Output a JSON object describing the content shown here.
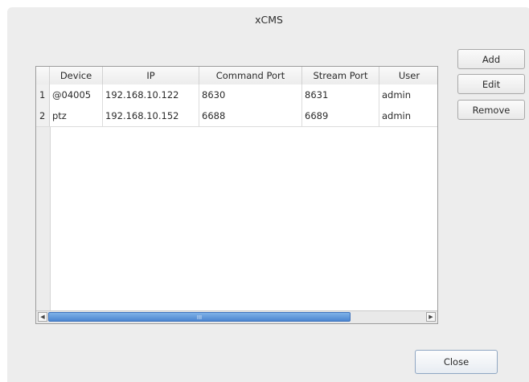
{
  "window": {
    "title": "xCMS"
  },
  "buttons": {
    "add": "Add",
    "edit": "Edit",
    "remove": "Remove",
    "close": "Close"
  },
  "table": {
    "columns": [
      "Device",
      "IP",
      "Command Port",
      "Stream Port",
      "User"
    ],
    "rows": [
      {
        "num": "1",
        "device": "@04005",
        "ip": "192.168.10.122",
        "command_port": "8630",
        "stream_port": "8631",
        "user": "admin"
      },
      {
        "num": "2",
        "device": "ptz",
        "ip": "192.168.10.152",
        "command_port": "6688",
        "stream_port": "6689",
        "user": "admin"
      }
    ]
  },
  "scrollbar": {
    "left_arrow": "◀",
    "right_arrow": "▶",
    "grip": "III",
    "thumb_accent": "#5a93d8"
  }
}
